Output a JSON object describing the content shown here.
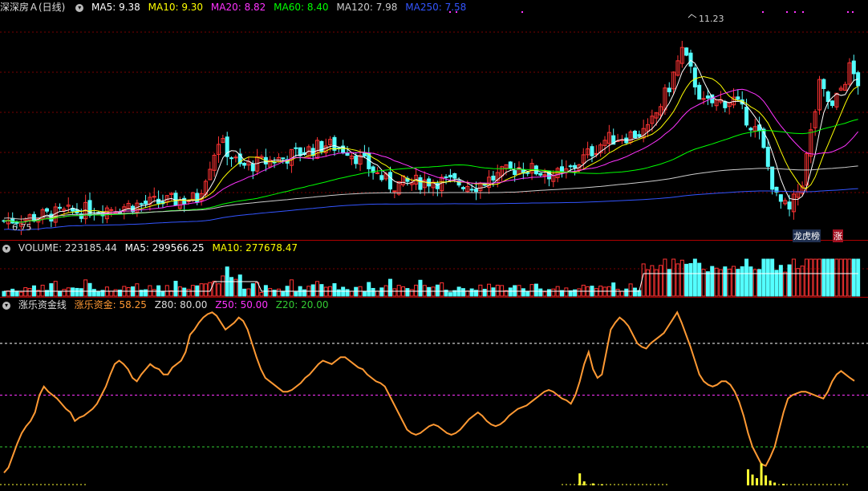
{
  "main_header": {
    "stock": "深深房Ａ(日线)",
    "items": [
      {
        "text": "MA5: 9.38",
        "color": "#ffffff"
      },
      {
        "text": "MA10: 9.30",
        "color": "#ffff00"
      },
      {
        "text": "MA20: 8.82",
        "color": "#ff33ff"
      },
      {
        "text": "MA60: 8.40",
        "color": "#00ff00"
      },
      {
        "text": "MA120: 7.98",
        "color": "#cccccc"
      },
      {
        "text": "MA250: 7.58",
        "color": "#3355ff"
      }
    ]
  },
  "volume_header": {
    "items": [
      {
        "text": "VOLUME: 223185.44",
        "color": "#dddddd"
      },
      {
        "text": "MA5: 299566.25",
        "color": "#ffffff"
      },
      {
        "text": "MA10: 277678.47",
        "color": "#ffff00"
      }
    ]
  },
  "indicator_header": {
    "items": [
      {
        "text": "涨乐资金线",
        "color": "#dddddd"
      },
      {
        "text": "涨乐资金: 58.25",
        "color": "#ff9933"
      },
      {
        "text": "Z80: 80.00",
        "color": "#dddddd"
      },
      {
        "text": "Z50: 50.00",
        "color": "#ff33ff"
      },
      {
        "text": "Z20: 20.00",
        "color": "#33cc33"
      }
    ]
  },
  "annotations": {
    "high_label": "11.23",
    "low_label": "6.75",
    "tag_lhb": "龙虎榜",
    "tag_zhang": "涨"
  },
  "chart_data": {
    "type": "candlestick",
    "price_range": [
      6.5,
      11.6
    ],
    "high": 11.23,
    "low": 6.75,
    "moving_averages": [
      "MA5",
      "MA10",
      "MA20",
      "MA60",
      "MA120",
      "MA250"
    ],
    "indicator": {
      "name": "涨乐资金线",
      "ylim": [
        0,
        100
      ],
      "levels": [
        80,
        50,
        20
      ],
      "values": [
        5,
        8,
        15,
        22,
        28,
        32,
        35,
        40,
        50,
        55,
        52,
        50,
        48,
        45,
        42,
        40,
        35,
        37,
        38,
        40,
        42,
        45,
        50,
        55,
        62,
        68,
        70,
        68,
        65,
        60,
        58,
        62,
        65,
        68,
        66,
        65,
        62,
        62,
        66,
        68,
        70,
        75,
        85,
        88,
        92,
        95,
        97,
        98,
        96,
        92,
        88,
        90,
        92,
        95,
        93,
        88,
        80,
        72,
        65,
        60,
        58,
        56,
        54,
        52,
        52,
        53,
        55,
        57,
        60,
        62,
        65,
        68,
        70,
        69,
        68,
        70,
        72,
        72,
        70,
        68,
        66,
        65,
        62,
        60,
        58,
        57,
        55,
        50,
        45,
        40,
        35,
        30,
        28,
        27,
        28,
        30,
        32,
        33,
        32,
        30,
        28,
        27,
        28,
        30,
        33,
        36,
        38,
        40,
        38,
        35,
        33,
        32,
        33,
        35,
        38,
        40,
        42,
        43,
        44,
        46,
        48,
        50,
        52,
        53,
        52,
        50,
        48,
        47,
        45,
        50,
        58,
        68,
        75,
        65,
        60,
        62,
        75,
        88,
        92,
        95,
        93,
        90,
        85,
        80,
        78,
        77,
        80,
        82,
        84,
        86,
        90,
        94,
        98,
        92,
        85,
        78,
        70,
        62,
        58,
        56,
        55,
        56,
        58,
        58,
        56,
        52,
        46,
        38,
        28,
        20,
        15,
        10,
        9,
        14,
        20,
        30,
        40,
        48,
        50,
        51,
        52,
        52,
        51,
        50,
        49,
        48,
        52,
        58,
        62,
        64,
        62,
        60,
        58.25
      ]
    }
  }
}
